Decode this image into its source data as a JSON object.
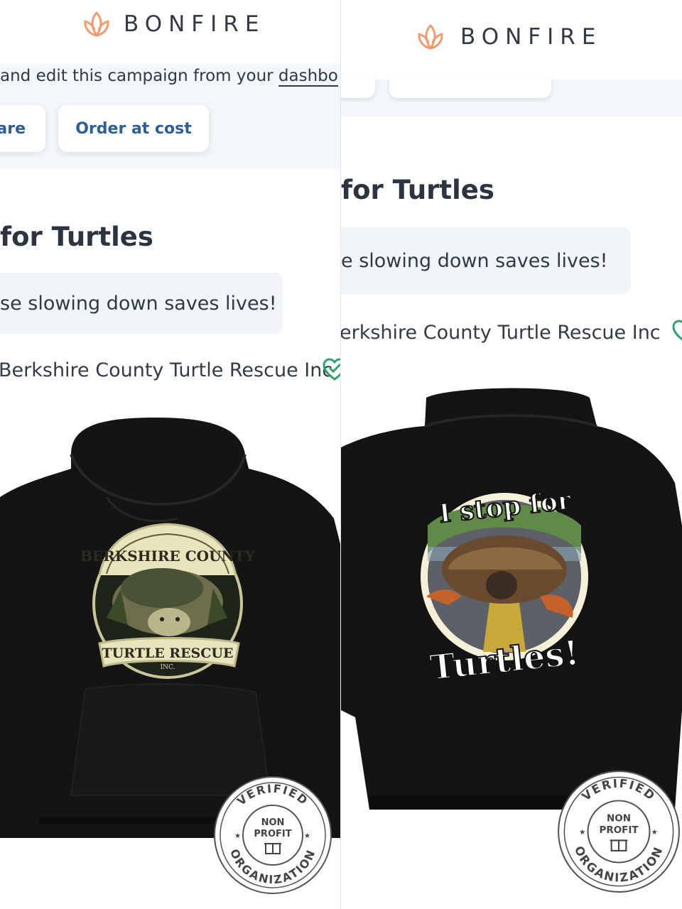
{
  "brand": {
    "name": "BONFIRE",
    "logo_icon": "flame-petal-icon",
    "logo_color": "#f29a6e"
  },
  "left": {
    "banner_text": "and edit this campaign from your dashbo",
    "banner_link": "dashbo",
    "buttons": [
      "are",
      "Order at cost"
    ],
    "title": "for Turtles",
    "description": "se slowing down saves lives!",
    "organization": "Berkshire County Turtle Rescue Inc",
    "verified_icon": "heart-check-icon",
    "product": {
      "type": "hoodie-front",
      "graphic_top": "BERKSHIRE COUNTY",
      "graphic_ribbon": "TURTLE RESCUE",
      "graphic_small": "INC."
    }
  },
  "right": {
    "title": "for Turtles",
    "description": "e slowing down saves lives!",
    "organization": "erkshire County Turtle Rescue Inc",
    "product": {
      "type": "hoodie-back",
      "graphic_top": "I stop for",
      "graphic_bottom": "Turtles!"
    }
  },
  "seal": {
    "top": "VERIFIED",
    "line1": "NON",
    "line2": "PROFIT",
    "bottom": "ORGANIZATION",
    "icon": "gift-icon"
  },
  "colors": {
    "accent": "#2d5f94",
    "verified": "#2fa36b",
    "hoodie": "#141414"
  }
}
